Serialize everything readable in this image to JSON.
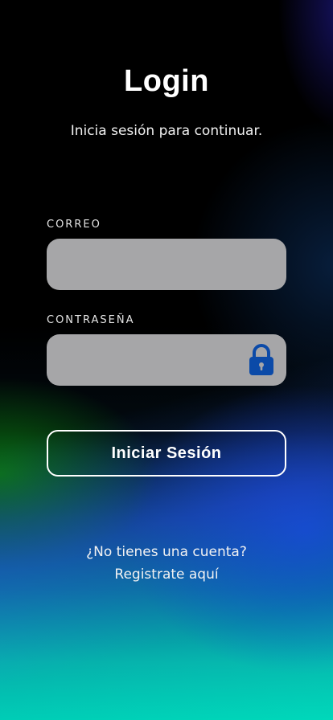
{
  "login": {
    "title": "Login",
    "subtitle": "Inicia sesión para continuar.",
    "email_label": "CORREO",
    "email_value": "",
    "password_label": "CONTRASEÑA",
    "password_value": "",
    "submit_label": "Iniciar Sesión",
    "no_account_text": "¿No tienes una cuenta?",
    "register_link": "Registrate aquí"
  },
  "icons": {
    "password_field": "lock-icon"
  },
  "colors": {
    "input_bg": "#a6a6a8",
    "lock_icon": "#0b4aa8",
    "text": "#ffffff",
    "button_border": "#ffffff"
  }
}
